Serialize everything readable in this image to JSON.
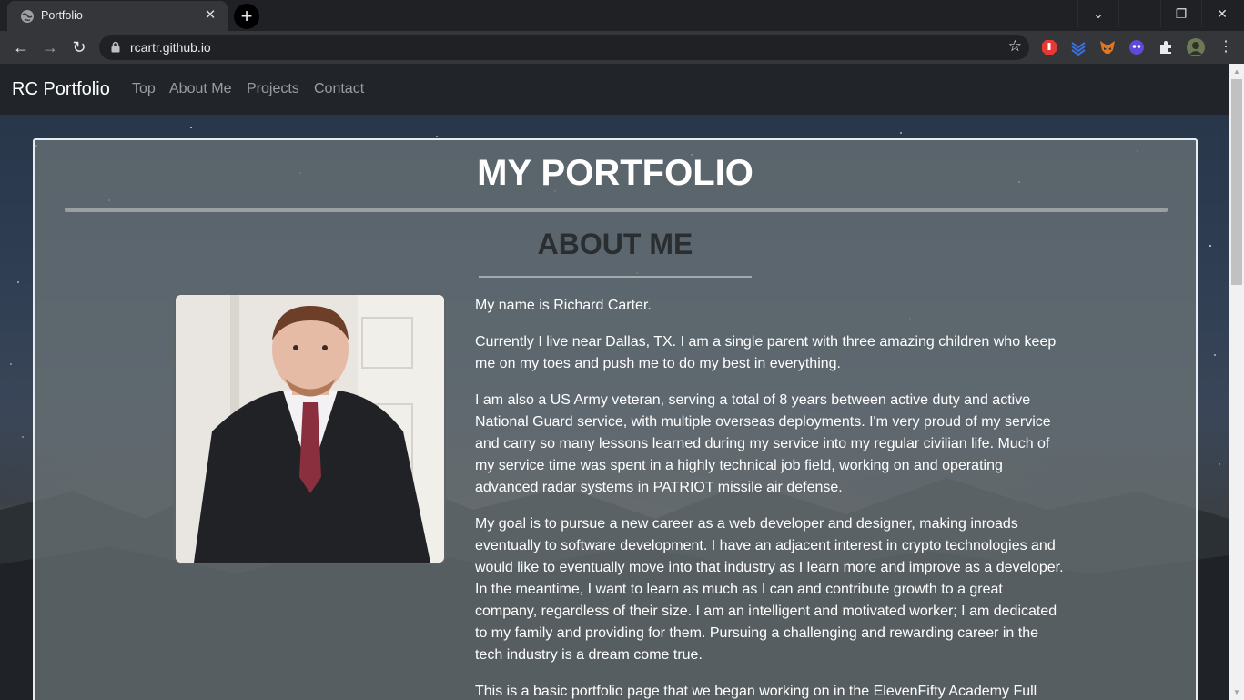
{
  "browser": {
    "tab_title": "Portfolio",
    "url": "rcartr.github.io"
  },
  "nav": {
    "brand": "RC Portfolio",
    "links": [
      "Top",
      "About Me",
      "Projects",
      "Contact"
    ]
  },
  "page": {
    "title": "MY PORTFOLIO",
    "section_title": "ABOUT ME",
    "paragraphs": [
      "My name is Richard Carter.",
      "Currently I live near Dallas, TX. I am a single parent with three amazing children who keep me on my toes and push me to do my best in everything.",
      "I am also a US Army veteran, serving a total of 8 years between active duty and active National Guard service, with multiple overseas deployments. I'm very proud of my service and carry so many lessons learned during my service into my regular civilian life. Much of my service time was spent in a highly technical job field, working on and operating advanced radar systems in PATRIOT missile air defense.",
      "My goal is to pursue a new career as a web developer and designer, making inroads eventually to software development. I have an adjacent interest in crypto technologies and would like to eventually move into that industry as I learn more and improve as a developer. In the meantime, I want to learn as much as I can and contribute growth to a great company, regardless of their size. I am an intelligent and motivated worker; I am dedicated to my family and providing for them. Pursuing a challenging and rewarding career in the tech industry is a dream come true.",
      "This is a basic portfolio page that we began working on in the ElevenFifty Academy Full"
    ]
  },
  "colors": {
    "navbar": "#212529",
    "panel_border": "#e9ecef",
    "brand_text": "#ffffff"
  }
}
